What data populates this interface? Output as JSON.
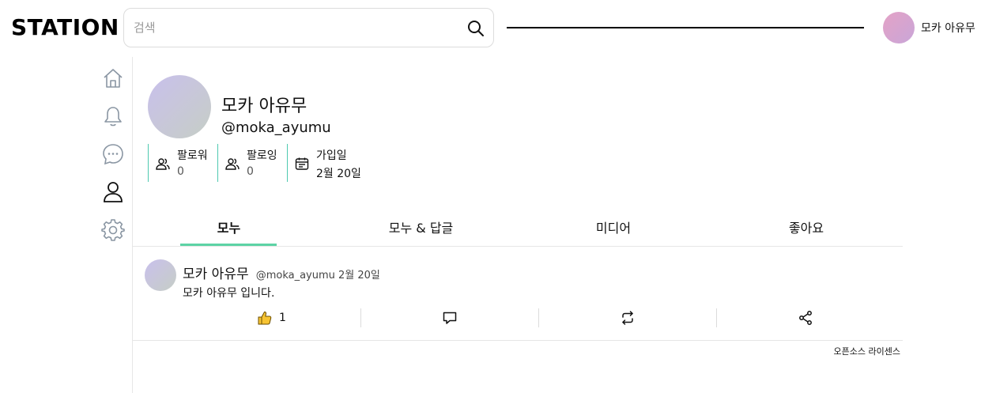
{
  "header": {
    "logo": "STATION",
    "search_placeholder": "검색",
    "user_name": "모카 아유무"
  },
  "sidebar": {
    "items": [
      {
        "icon": "home-icon"
      },
      {
        "icon": "bell-icon"
      },
      {
        "icon": "chat-icon"
      },
      {
        "icon": "user-icon"
      },
      {
        "icon": "gear-icon"
      }
    ]
  },
  "profile": {
    "name": "모카 아유무",
    "handle": "@moka_ayumu",
    "stats": [
      {
        "label": "팔로워",
        "value": "0",
        "icon": "users-icon"
      },
      {
        "label": "팔로잉",
        "value": "0",
        "icon": "users-icon"
      },
      {
        "label": "가입일",
        "value": "2월 20일",
        "icon": "calendar-icon"
      }
    ]
  },
  "tabs": [
    {
      "label": "모누",
      "active": true
    },
    {
      "label": "모누 & 답글",
      "active": false
    },
    {
      "label": "미디어",
      "active": false
    },
    {
      "label": "좋아요",
      "active": false
    }
  ],
  "post": {
    "author": "모카 아유무",
    "meta": "@moka_ayumu 2월 20일",
    "body": "모카 아유무 입니다.",
    "like_count": "1"
  },
  "footer": {
    "license": "오픈소스 라이센스"
  },
  "colors": {
    "accent": "#5dd3a5",
    "stat_border": "#4ec9b0"
  }
}
